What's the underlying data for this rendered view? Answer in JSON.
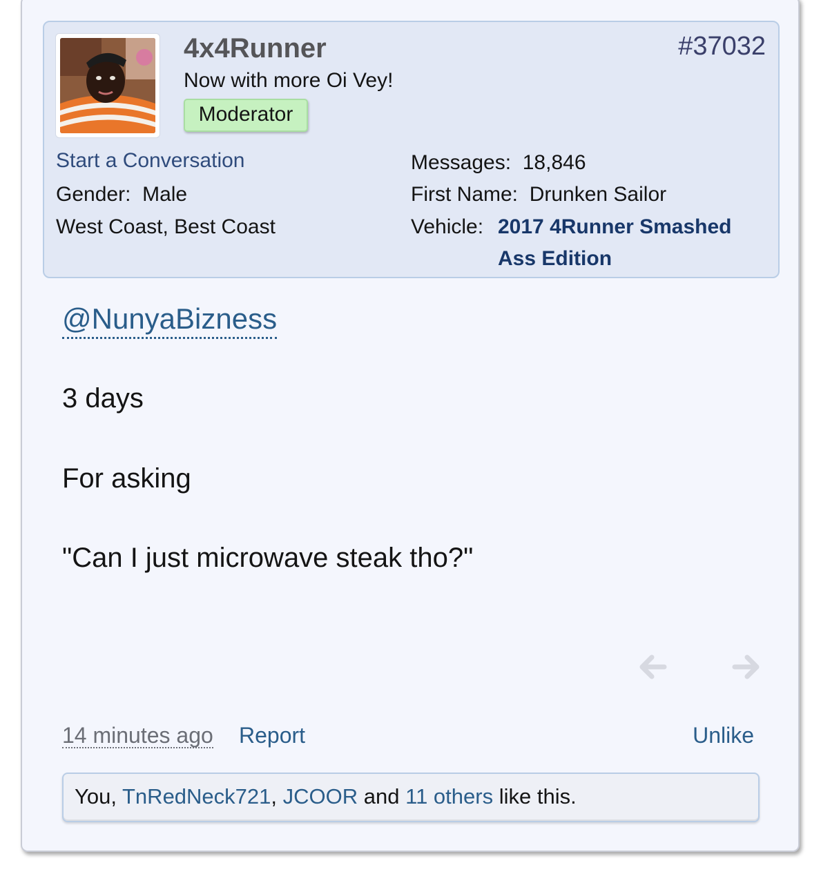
{
  "post": {
    "number": "#37032",
    "user": {
      "name": "4x4Runner",
      "title": "Now with more Oi Vey!",
      "badge": "Moderator",
      "start_conversation": "Start a Conversation",
      "gender_label": "Gender:",
      "gender": "Male",
      "location": "West Coast, Best Coast",
      "messages_label": "Messages:",
      "messages": "18,846",
      "first_name_label": "First Name:",
      "first_name": "Drunken Sailor",
      "vehicle_label": "Vehicle:",
      "vehicle": "2017 4Runner Smashed Ass Edition"
    },
    "body": {
      "mention": "@NunyaBizness",
      "lines": [
        "3 days",
        "For asking",
        "\"Can I just microwave steak tho?\""
      ]
    },
    "nav": {
      "prev_icon": "arrow-left-icon",
      "next_icon": "arrow-right-icon"
    },
    "footer": {
      "timestamp": "14 minutes ago",
      "report": "Report",
      "unlike": "Unlike"
    },
    "likes": {
      "you": "You,",
      "user1": "TnRedNeck721",
      "sep1": ",",
      "user2": "JCOOR",
      "and": "and",
      "others": "11 others",
      "suffix": "like this."
    }
  },
  "colors": {
    "card_bg": "#f4f6fd",
    "userbox_bg": "#e2e8f5",
    "link": "#2a5d8a",
    "vehicle": "#183769",
    "badge_bg": "#c6f1c0"
  }
}
